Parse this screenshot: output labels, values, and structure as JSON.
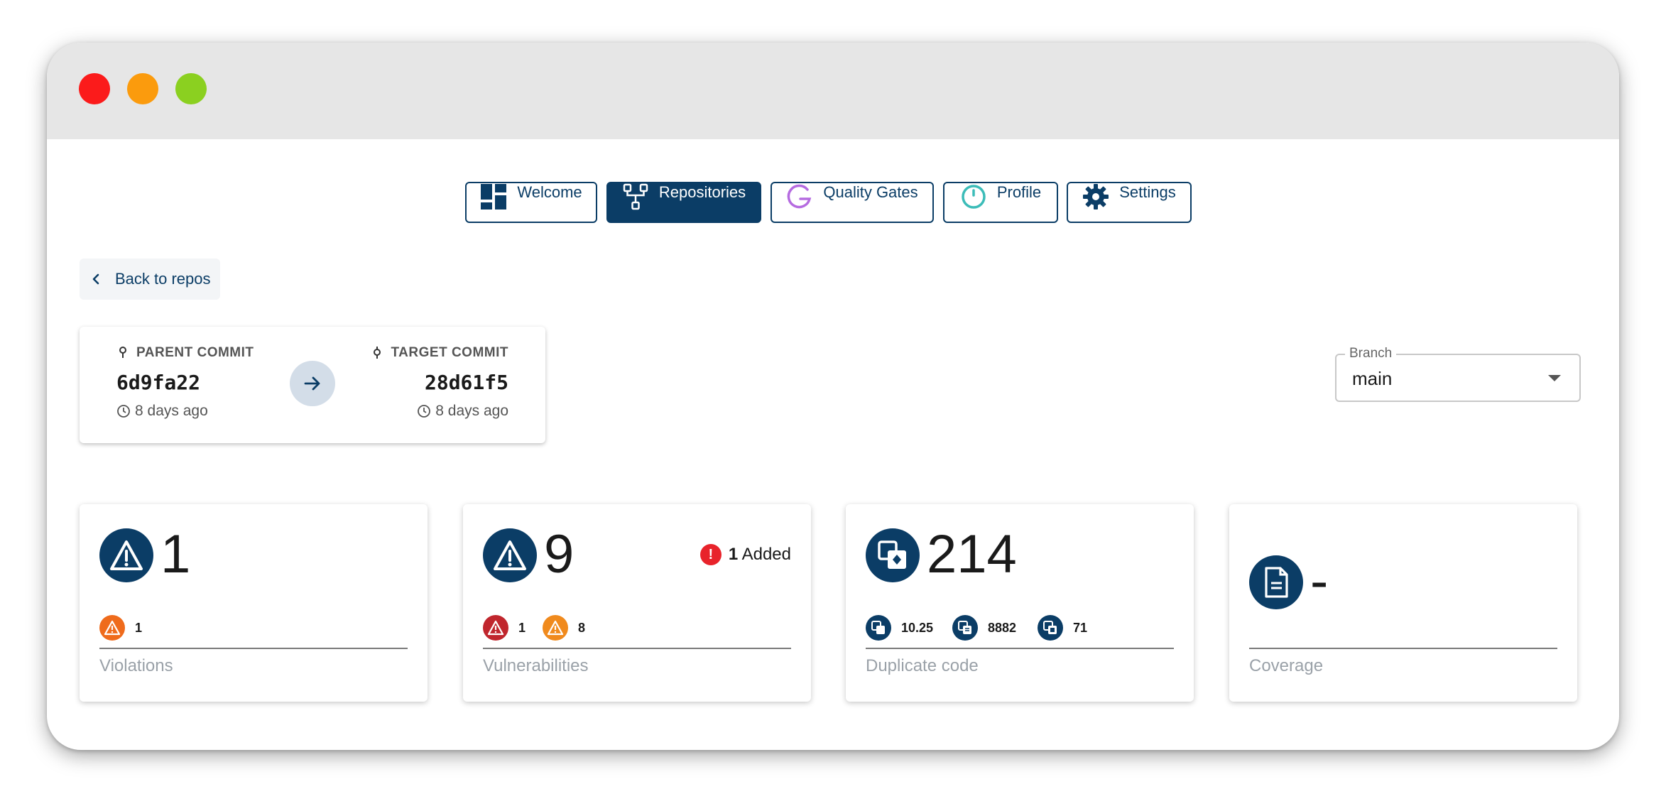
{
  "nav": {
    "welcome": "Welcome",
    "repositories": "Repositories",
    "quality_gates": "Quality Gates",
    "profile": "Profile",
    "settings": "Settings"
  },
  "back_label": "Back to repos",
  "commits": {
    "parent": {
      "label": "PARENT COMMIT",
      "hash": "6d9fa22",
      "time": "8 days ago"
    },
    "target": {
      "label": "TARGET COMMIT",
      "hash": "28d61f5",
      "time": "8 days ago"
    }
  },
  "branch": {
    "label": "Branch",
    "value": "main"
  },
  "cards": {
    "violations": {
      "value": "1",
      "title": "Violations",
      "high": "1"
    },
    "vulnerabilities": {
      "value": "9",
      "title": "Vulnerabilities",
      "critical": "1",
      "high": "8",
      "added_count": "1",
      "added_label": "Added"
    },
    "duplicate": {
      "value": "214",
      "title": "Duplicate code",
      "stat1": "10.25",
      "stat2": "8882",
      "stat3": "71"
    },
    "coverage": {
      "value": "-",
      "title": "Coverage"
    }
  },
  "colors": {
    "brand": "#0b3d66",
    "high": "#ef6b1c",
    "critical": "#c0262d",
    "added": "#e8232b"
  }
}
